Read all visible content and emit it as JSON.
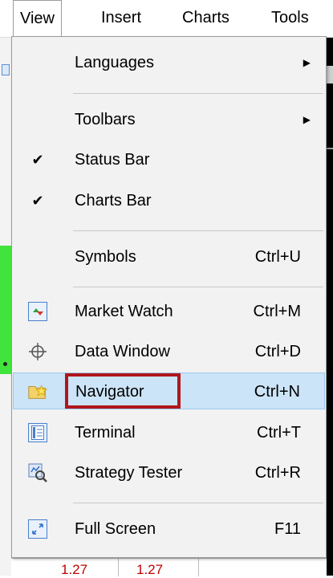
{
  "menubar": {
    "items": [
      {
        "label": "View"
      },
      {
        "label": "Insert"
      },
      {
        "label": "Charts"
      },
      {
        "label": "Tools"
      }
    ]
  },
  "view_menu": {
    "items": [
      {
        "label": "Languages",
        "submenu": true
      },
      {
        "label": "Toolbars",
        "submenu": true
      },
      {
        "label": "Status Bar",
        "checked": true
      },
      {
        "label": "Charts Bar",
        "checked": true
      },
      {
        "label": "Symbols",
        "shortcut": "Ctrl+U"
      },
      {
        "label": "Market Watch",
        "shortcut": "Ctrl+M",
        "icon": "market-watch-icon"
      },
      {
        "label": "Data Window",
        "shortcut": "Ctrl+D",
        "icon": "crosshair-icon"
      },
      {
        "label": "Navigator",
        "shortcut": "Ctrl+N",
        "icon": "navigator-folder-star-icon",
        "hovered": true
      },
      {
        "label": "Terminal",
        "shortcut": "Ctrl+T",
        "icon": "terminal-icon"
      },
      {
        "label": "Strategy Tester",
        "shortcut": "Ctrl+R",
        "icon": "strategy-tester-icon"
      },
      {
        "label": "Full Screen",
        "shortcut": "F11",
        "icon": "full-screen-icon"
      }
    ]
  },
  "background": {
    "quote_cells": [
      "1.27",
      "1.27"
    ]
  },
  "colors": {
    "menu_bg": "#f2f2f2",
    "hover_bg": "#cce4f7",
    "highlight_border": "#b0161b",
    "quote_text": "#c00000"
  }
}
